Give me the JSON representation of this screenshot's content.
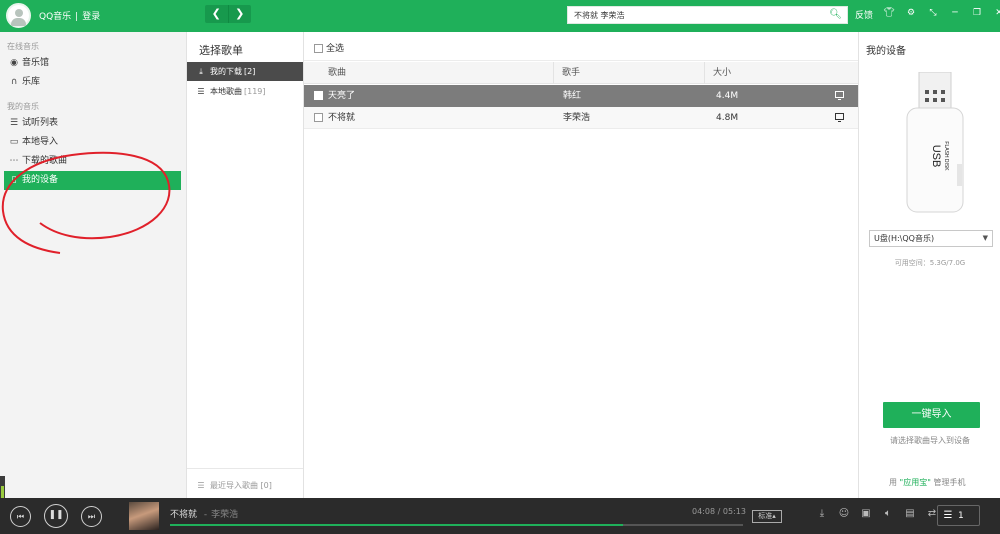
{
  "app": {
    "name": "QQ音乐",
    "login": "登录",
    "back_icon": "chevron-left-icon",
    "forward_icon": "chevron-right-icon"
  },
  "search": {
    "value": "不将就 李荣浩",
    "icon": "search-icon"
  },
  "topbar": {
    "feedback": "反馈",
    "icons": [
      "shirt-icon",
      "gear-icon",
      "mini-mode-icon",
      "minimize-icon",
      "restore-icon",
      "close-icon"
    ]
  },
  "sidebar": {
    "section_online": "在线音乐",
    "online_items": [
      {
        "label": "音乐馆",
        "icon": "music-hall-icon"
      },
      {
        "label": "乐库",
        "icon": "headphones-icon"
      }
    ],
    "section_mine": "我的音乐",
    "mine_items": [
      {
        "label": "试听列表",
        "icon": "list-icon"
      },
      {
        "label": "本地导入",
        "icon": "monitor-icon"
      },
      {
        "label": "下载的歌曲",
        "icon": "download-icon"
      },
      {
        "label": "我的设备",
        "icon": "device-icon",
        "active": true
      }
    ]
  },
  "playlist": {
    "title": "选择歌单",
    "items": [
      {
        "label": "我的下载",
        "count": "[2]",
        "icon": "download-icon",
        "active": true
      },
      {
        "label": "本地歌曲",
        "count": "[119]",
        "icon": "list-icon"
      }
    ],
    "footer": "最近导入歌曲 [0]"
  },
  "main": {
    "select_all": "全选",
    "columns": {
      "song": "歌曲",
      "artist": "歌手",
      "size": "大小"
    },
    "rows": [
      {
        "song": "天亮了",
        "artist": "韩红",
        "size": "4.4M",
        "selected": true
      },
      {
        "song": "不将就",
        "artist": "李荣浩",
        "size": "4.8M",
        "selected": false
      }
    ]
  },
  "device": {
    "title": "我的设备",
    "usb_text": "USB",
    "usb_sub": "FLASH DISK",
    "drive": "U盘(H:\\QQ音乐)",
    "space": "可用空间：5.3G/7.0G",
    "import_button": "一键导入",
    "import_hint": "请选择歌曲导入到设备",
    "footer_prefix": "用",
    "footer_app": "\"应用宝\"",
    "footer_suffix": "管理手机"
  },
  "player": {
    "song": "不将就",
    "separator": "-",
    "artist": "李荣浩",
    "elapsed": "04:08",
    "duration": "05:13",
    "time_separator": "/",
    "progress_fraction": 0.79,
    "quality": "标准",
    "playlist_count": "1"
  },
  "colors": {
    "accent": "#1fb05a",
    "player_bg": "#2b2b2b",
    "selected_row": "#7c7c7c",
    "annotation": "#e0202a"
  }
}
